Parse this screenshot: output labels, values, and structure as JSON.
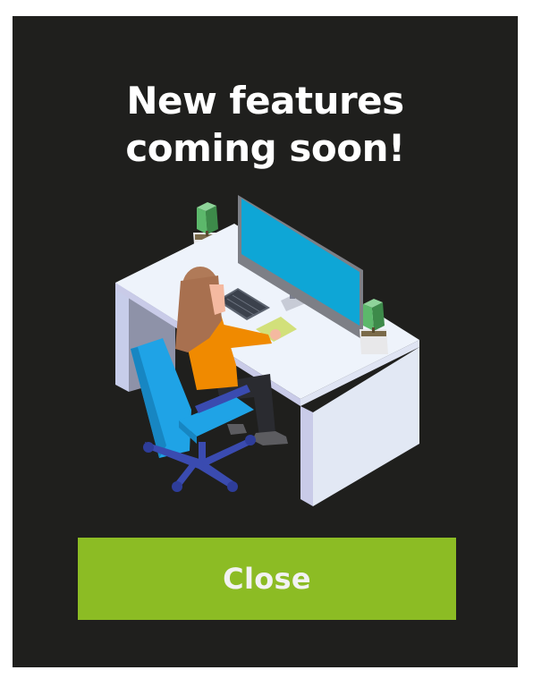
{
  "dialog": {
    "title_line1": "New features",
    "title_line2": "coming soon!",
    "close_label": "Close"
  },
  "colors": {
    "background": "#1f1f1d",
    "title_text": "#ffffff",
    "button_bg": "#8cbc24",
    "button_text": "#f2f2f2"
  },
  "illustration": {
    "subject": "person working at desk with monitor, keyboard and potted plants"
  }
}
